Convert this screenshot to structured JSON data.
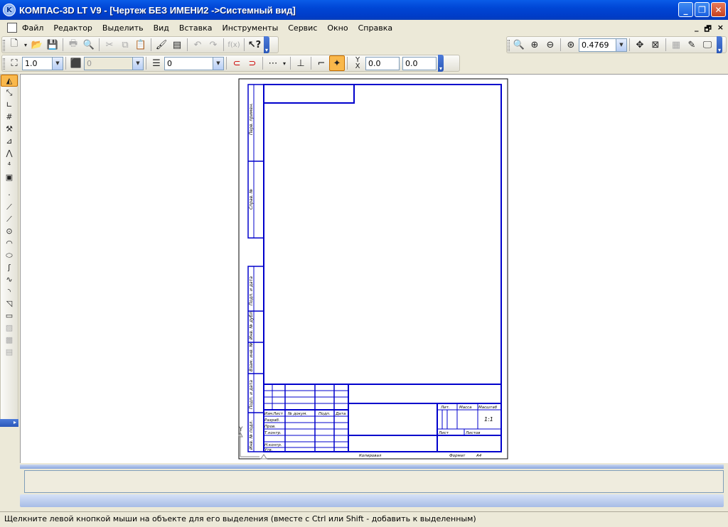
{
  "window": {
    "title": "КОМПАС-3D LT V9 - [Чертеж БЕЗ ИМЕНИ2 ->Системный вид]",
    "controls": [
      "minimize",
      "restore",
      "close"
    ]
  },
  "menu": {
    "items": [
      "Файл",
      "Редактор",
      "Выделить",
      "Вид",
      "Вставка",
      "Инструменты",
      "Сервис",
      "Окно",
      "Справка"
    ]
  },
  "mdi_controls": {
    "minimize": "_",
    "restore": "🗗",
    "close": "×"
  },
  "view_toolbar": {
    "zoom_value": "0.4769"
  },
  "format_toolbar": {
    "line_width": "1.0",
    "style_value": "0",
    "layer_value": "0",
    "coord_label": "Y",
    "coord_label_sub": "X",
    "coord_x": "0.0",
    "coord_y": "0.0"
  },
  "icons": {
    "std": [
      "new-doc-icon",
      "new-arrow-icon",
      "open-icon",
      "save-icon",
      "print-icon",
      "preview-icon",
      "cut-icon",
      "copy-icon",
      "paste-icon",
      "format-brush-icon",
      "properties-icon",
      "undo-icon",
      "redo-icon",
      "function-icon",
      "help-pointer-icon"
    ],
    "view": [
      "zoom-icon",
      "zoom-in-icon",
      "zoom-out-icon",
      "zoom-scale-icon",
      "pan-icon",
      "fit-icon",
      "refresh-icon",
      "edit-icon",
      "display-icon"
    ],
    "left": [
      "geometry-icon",
      "dimensions-icon",
      "designations-icon",
      "edit-objects-icon",
      "parametric-icon",
      "measure-icon",
      "select-icon",
      "associative-icon",
      "spec-icon",
      "point-icon",
      "aux-line-icon",
      "segment-icon",
      "circle-icon",
      "arc-icon",
      "ellipse-icon",
      "continuous-input-icon",
      "bezier-icon",
      "fillet-icon",
      "chamfer-icon",
      "rectangle-icon",
      "hatch-icon",
      "fill-icon",
      "equidistant-icon"
    ]
  },
  "drawing": {
    "side_labels": [
      "Перв. примен.",
      "Справ. №",
      "Подп. и дата",
      "Инв. № дубл.",
      "Взам. инв. №",
      "Подп. и дата",
      "Инв. № подл."
    ],
    "title_block": {
      "header_cols": [
        "Изм.",
        "Лист",
        "№ докум.",
        "Подп.",
        "Дата"
      ],
      "rows": [
        "Разраб.",
        "Пров.",
        "Т.контр.",
        "Н.контр.",
        "Утв."
      ],
      "lit": "Лит.",
      "mass": "Масса",
      "scale": "Масштаб",
      "scale_value": "1:1",
      "sheet": "Лист",
      "sheets": "Листов",
      "copied": "Копировал",
      "format": "Формат",
      "format_value": "A4"
    },
    "origin_label": "Y"
  },
  "status": {
    "text": "Щелкните левой кнопкой мыши на объекте для его выделения (вместе с Ctrl или Shift - добавить к выделенным)"
  }
}
